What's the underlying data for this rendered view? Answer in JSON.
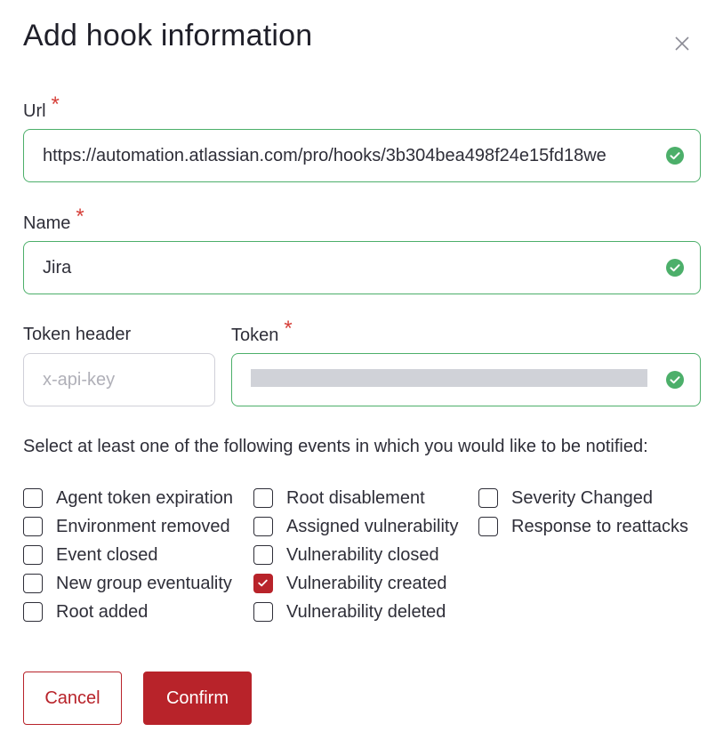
{
  "dialog": {
    "title": "Add hook information",
    "close_icon": "close-icon"
  },
  "form": {
    "url": {
      "label": "Url",
      "required_mark": "*",
      "value": "https://automation.atlassian.com/pro/hooks/3b304bea498f24e15fd18we",
      "status_icon": "check-circle-icon"
    },
    "name": {
      "label": "Name",
      "required_mark": "*",
      "value": "Jira",
      "status_icon": "check-circle-icon"
    },
    "token_header": {
      "label": "Token header",
      "placeholder": "x-api-key",
      "value": ""
    },
    "token": {
      "label": "Token",
      "required_mark": "*",
      "status_icon": "check-circle-icon"
    },
    "events_instructions": "Select at least one of the following events in which you would like to be notified:",
    "events": {
      "col1": [
        {
          "label": "Agent token expiration",
          "checked": false
        },
        {
          "label": "Environment removed",
          "checked": false
        },
        {
          "label": "Event closed",
          "checked": false
        },
        {
          "label": "New group eventuality",
          "checked": false
        },
        {
          "label": "Root added",
          "checked": false
        }
      ],
      "col2": [
        {
          "label": "Root disablement",
          "checked": false
        },
        {
          "label": "Assigned vulnerability",
          "checked": false
        },
        {
          "label": "Vulnerability closed",
          "checked": false
        },
        {
          "label": "Vulnerability created",
          "checked": true
        },
        {
          "label": "Vulnerability deleted",
          "checked": false
        }
      ],
      "col3": [
        {
          "label": "Severity Changed",
          "checked": false
        },
        {
          "label": "Response to reattacks",
          "checked": false
        }
      ]
    }
  },
  "actions": {
    "cancel_label": "Cancel",
    "confirm_label": "Confirm"
  },
  "colors": {
    "accent": "#b8232a",
    "valid_border": "#4caf6a",
    "required": "#d6403a"
  }
}
